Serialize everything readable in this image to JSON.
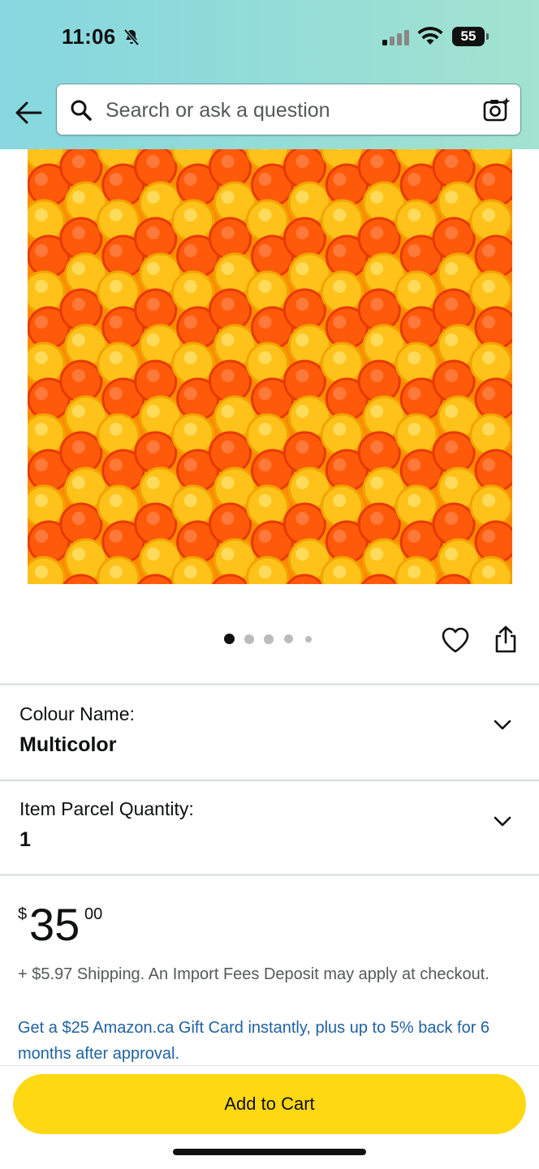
{
  "status_bar": {
    "time": "11:06",
    "battery": "55"
  },
  "search": {
    "placeholder": "Search or ask a question",
    "value": ""
  },
  "icons": {
    "back": "back-arrow-icon",
    "search": "search-icon",
    "camera": "camera-search-icon",
    "favorite": "heart-icon",
    "share": "share-icon"
  },
  "product": {
    "image_colors": [
      "#ff5a0a",
      "#ffc21a"
    ],
    "carousel_dots": 5,
    "carousel_active_index": 0
  },
  "variations": [
    {
      "label": "Colour Name:",
      "value": "Multicolor"
    },
    {
      "label": "Item Parcel Quantity:",
      "value": "1"
    }
  ],
  "price": {
    "symbol": "$",
    "whole": "35",
    "fraction": "00"
  },
  "shipping_text": "+ $5.97 Shipping. An Import Fees Deposit may apply at checkout.",
  "gift_card_text": "Get a $25 Amazon.ca Gift Card instantly, plus up to 5% back for 6 months after approval.",
  "add_to_cart_label": "Add to Cart",
  "colors": {
    "header_gradient_start": "#86d7e0",
    "header_gradient_end": "#a3e3cf",
    "button_yellow": "#ffd814",
    "link_blue": "#2162a1"
  }
}
